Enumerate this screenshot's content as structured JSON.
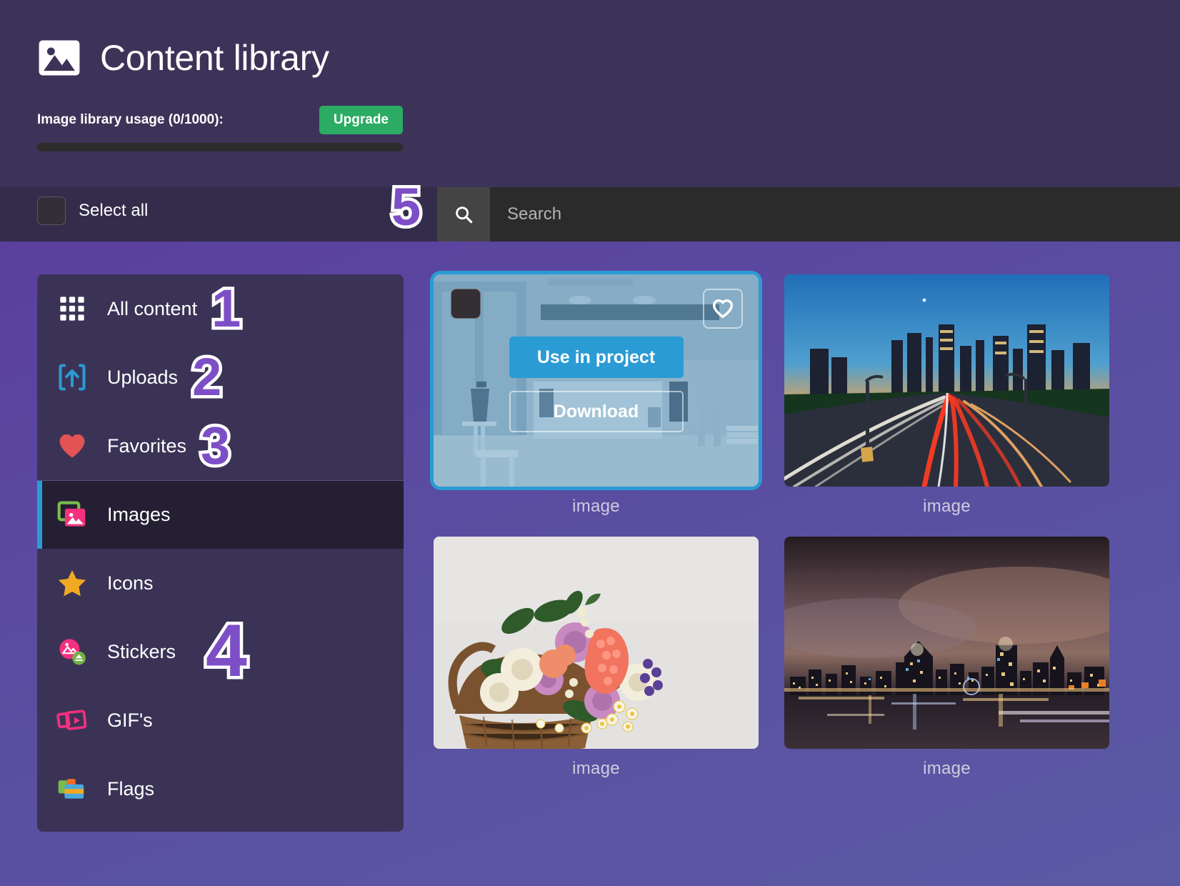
{
  "header": {
    "title": "Content library",
    "logo_icon": "image-icon",
    "usage_label": "Image library usage (0/1000):",
    "upgrade_label": "Upgrade",
    "usage_percent": 0,
    "usage_used": 0,
    "usage_total": 1000
  },
  "toolbar": {
    "select_all_label": "Select all",
    "select_all_checked": false,
    "search_placeholder": "Search",
    "search_value": "",
    "search_icon": "search-icon",
    "annotation": "5"
  },
  "sidebar": {
    "items": [
      {
        "label": "All content",
        "icon": "grid-icon",
        "active": false,
        "annotation": "1"
      },
      {
        "label": "Uploads",
        "icon": "upload-icon",
        "active": false,
        "annotation": "2"
      },
      {
        "label": "Favorites",
        "icon": "heart-icon",
        "active": false,
        "annotation": "3"
      },
      {
        "label": "Images",
        "icon": "images-icon",
        "active": true,
        "annotation": ""
      },
      {
        "label": "Icons",
        "icon": "star-icon",
        "active": false,
        "annotation": ""
      },
      {
        "label": "Stickers",
        "icon": "sticker-icon",
        "active": false,
        "annotation": "4"
      },
      {
        "label": "GIF's",
        "icon": "gif-icon",
        "active": false,
        "annotation": ""
      },
      {
        "label": "Flags",
        "icon": "flags-icon",
        "active": false,
        "annotation": ""
      }
    ]
  },
  "grid": {
    "cards": [
      {
        "caption": "image",
        "selected": true,
        "hovered": true,
        "subject": "cafe-interior",
        "use_label": "Use in project",
        "download_label": "Download",
        "favorite_icon": "heart-outline-icon",
        "checkbox_checked": false
      },
      {
        "caption": "image",
        "selected": false,
        "hovered": false,
        "subject": "highway-light-trails"
      },
      {
        "caption": "image",
        "selected": false,
        "hovered": false,
        "subject": "flower-basket"
      },
      {
        "caption": "image",
        "selected": false,
        "hovered": false,
        "subject": "night-city-harbor"
      }
    ]
  },
  "colors": {
    "header_bg": "#3d3358",
    "toolbar_bg": "#342c4b",
    "sidebar_bg": "#3b3356",
    "active_item_bg": "#241f33",
    "accent_blue": "#2a9bd4",
    "accent_green": "#2bab63",
    "annotation_purple": "#7d4fc6"
  }
}
